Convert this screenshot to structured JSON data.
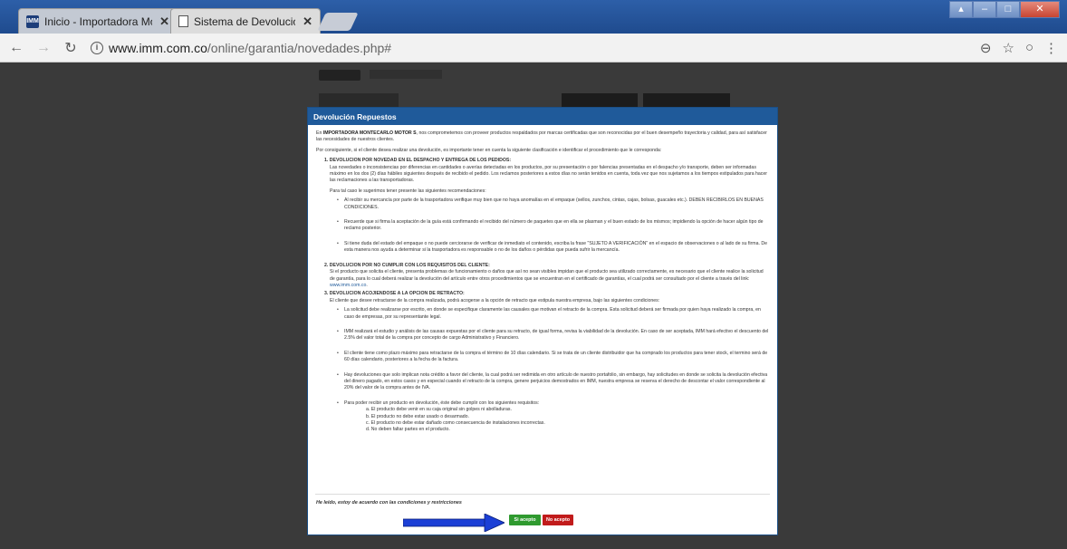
{
  "browser": {
    "tabs": [
      {
        "label": "Inicio - Importadora Mon",
        "favicon": "imm-logo-icon",
        "active": false
      },
      {
        "label": "Sistema de Devoluciones",
        "favicon": "document-icon",
        "active": true
      }
    ],
    "favicon_text": "IMM",
    "url_domain": "www.imm.com.co",
    "url_path": "/online/garantia/novedades.php#"
  },
  "modal": {
    "title": "Devolución Repuestos",
    "intro_1_pre": "En ",
    "intro_1_company": "IMPORTADORA MONTECARLO MOTOR S",
    "intro_1_post": ", nos comprometemos con proveer productos respaldados por marcas certificadas que son reconocidas por el buen desempeño trayectoria y calidad, para así satisfacer las necesidades de nuestros clientes.",
    "intro_2": "Por consiguiente, si el cliente desea realizar una devolución, es importante tener en cuenta la siguiente clasificación e identificar el procedimiento que le corresponda:",
    "section1": {
      "title": "1. DEVOLUCION POR NOVEDAD EN EL DESPACHO Y ENTREGA DE LOS PEDIDOS:",
      "text": "Las novedades o inconsistencias por diferencias en cantidades o averías detectadas en los productos, por su presentación o por falencias presentadas en el despacho y/o transporte, deben ser informadas máximo en los dos (2) días hábiles siguientes después de recibido el pedido. Los reclamos posteriores a estos días no serán tenidos en cuenta, toda vez que nos sujetamos a los tiempos estipulados para hacer las reclamaciones a las transportadoras.",
      "lead": "Para tal caso le sugerimos tener presente las siguientes recomendaciones:",
      "bullets": [
        "Al recibir su mercancía por parte de la trasportadora verifique muy bien que no haya anomalías en el empaque (sellos, zunchos, cintas, cajas, bolsas, guacales etc.). DEBEN RECIBIRLOS EN BUENAS CONDICIONES.",
        "Recuerde que si firma la aceptación de la guía está confirmando el recibido del número de paquetes que en ella se plasman y el buen estado de los mismos; impidiendo la opción de hacer algún tipo de reclamo posterior.",
        "Si tiene duda del estado del empaque o no puede cerciorarse de verificar de inmediato el contenido, escriba la frase \"SUJETO A VERIFICACIÓN\" en el espacio de observaciones o al lado de su firma. De esta manera nos ayuda a determinar si la trasportadora es responsable o no de los daños o pérdidas que pueda sufrir la mercancía."
      ]
    },
    "section2": {
      "title": "2. DEVOLUCION POR NO CUMPLIR CON LOS REQUISITOS DEL CLIENTE:",
      "text": "Si el producto que solicita el cliente, presenta problemas de funcionamiento o daños que así no sean visibles impidan que el producto sea utilizado correctamente, es necesario que el cliente realice la solicitud de garantía, para lo cual deberá realizar la devolución del artículo entre otros procedimientos que se encuentran en el certificado de garantías, el cual podrá ser consultado por el cliente a través del link: ",
      "link": "www.imm.com.co",
      "link_suffix": "."
    },
    "section3": {
      "title": "3. DEVOLUCION ACOJIENDOSE A LA OPCION DE RETRACTO:",
      "text": "El cliente que desee retractarse de la compra realizada, podrá acogerse a la opción de retracto que estipula nuestra empresa, bajo las siguientes condiciones:",
      "bullets": [
        "La solicitud debe realizarse por escrito, en donde se especifique claramente las causales que motivan el retracto de la compra. Esta solicitud deberá ser firmada por quien haya realizado la compra, en caso de empresas, por su representante legal.",
        "IMM realizará el estudio y análisis de las causas expuestas por el cliente para su retracto, de igual forma, revisa la viabilidad de la devolución. En caso de ser aceptada, IMM hará efectivo el descuento del 2.5% del valor total de la compra por concepto de cargo Administrativo y Financiero.",
        "El cliente tiene como plazo máximo para retractarse de la compra el término de 10 días calendario. Si se trata de un cliente distribuidor que ha comprado los productos para tener stock, el termino será de 60 días calendario, posteriores a la fecha de la factura.",
        "Hay devoluciones que solo implican nota crédito a favor del cliente, la cual podrá ser redimida en otro artículo de nuestro portafolio, sin embargo, hay solicitudes en donde se solicita la devolución efectiva del dinero pagado, en estos casos y en especial cuando el retracto de la compra, genere perjuicios demostrados en IMM, nuestra empresa se reserva el derecho de descontar el valor correspondiente al 20% del valor de la compra antes de IVA.",
        "Para poder recibir un producto en devolución, éste debe cumplir con los siguientes requisitos:"
      ],
      "requirements": [
        "a. El producto debe venir en su caja original sin golpes ni abolladuras.",
        "b. El producto no debe estar usado o desarmado.",
        "c. El producto no debe estar dañado como consecuencia de instalaciones incorrectas.",
        "d. No deben faltar partes en el producto."
      ]
    },
    "accept_statement": "He leído, estoy de acuerdo con las condiciones y restricciones",
    "accept_button": "Si acepto",
    "reject_button": "No acepto",
    "colors": {
      "header": "#1f5a9a",
      "accept": "#2f9a2f",
      "reject": "#c11b1b",
      "arrow": "#1b3fd6"
    }
  }
}
